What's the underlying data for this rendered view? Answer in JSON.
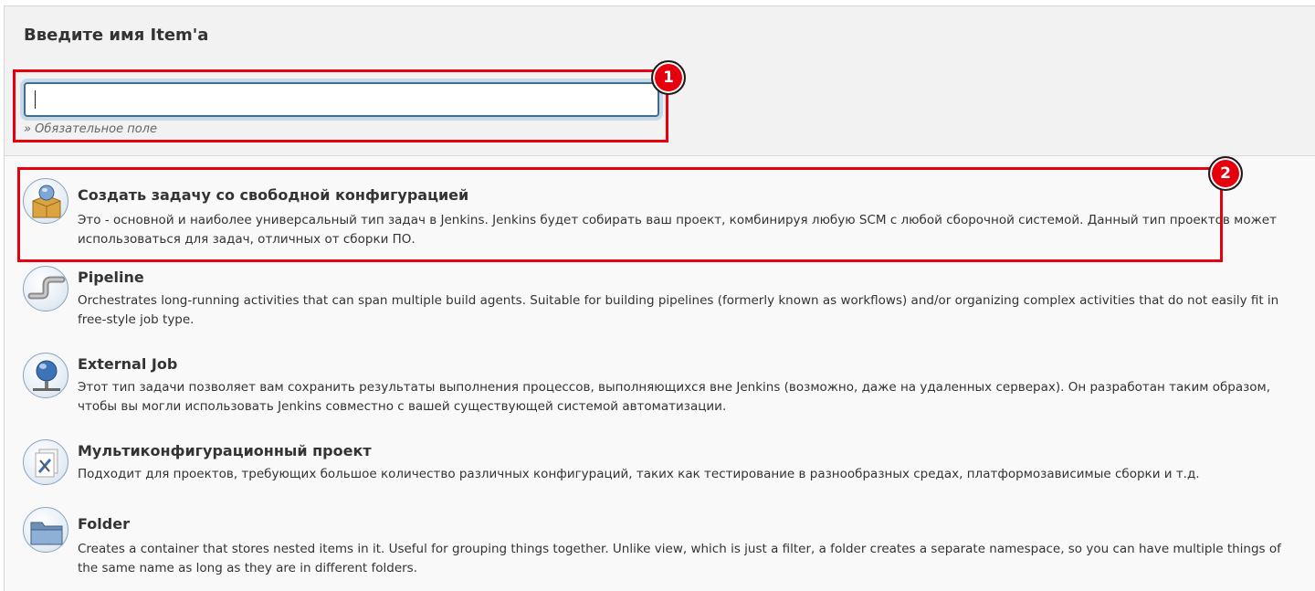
{
  "header": {
    "title": "Введите имя Item'a",
    "name_input": {
      "value": "",
      "placeholder": ""
    },
    "required_note": "» Обязательное поле"
  },
  "items": [
    {
      "icon": "freestyle-project-icon",
      "title": "Создать задачу со свободной конфигурацией",
      "description": "Это - основной и наиболее универсальный тип задач в Jenkins. Jenkins будет собирать ваш проект, комбинируя любую SCM с любой сборочной системой. Данный тип проектов может использоваться для задач, отличных от сборки ПО."
    },
    {
      "icon": "pipeline-icon",
      "title": "Pipeline",
      "description": "Orchestrates long-running activities that can span multiple build agents. Suitable for building pipelines (formerly known as workflows) and/or organizing complex activities that do not easily fit in free-style job type."
    },
    {
      "icon": "external-job-icon",
      "title": "External Job",
      "description": "Этот тип задачи позволяет вам сохранить результаты выполнения процессов, выполняющихся вне Jenkins (возможно, даже на удаленных серверах). Он разработан таким образом, чтобы вы могли использовать Jenkins совместно с вашей существующей системой автоматизации."
    },
    {
      "icon": "multi-configuration-project-icon",
      "title": "Мультиконфигурационный проект",
      "description": "Подходит для проектов, требующих большое количество различных конфигураций, таких как тестирование в разнообразных средах, платформозависимые сборки и т.д."
    },
    {
      "icon": "folder-icon",
      "title": "Folder",
      "description": "Creates a container that stores nested items in it. Useful for grouping things together. Unlike view, which is just a filter, a folder creates a separate namespace, so you can have multiple things of the same name as long as they are in different folders."
    }
  ],
  "annotations": [
    {
      "label": "1",
      "color": "#e6000d"
    },
    {
      "label": "2",
      "color": "#e6000d"
    }
  ]
}
